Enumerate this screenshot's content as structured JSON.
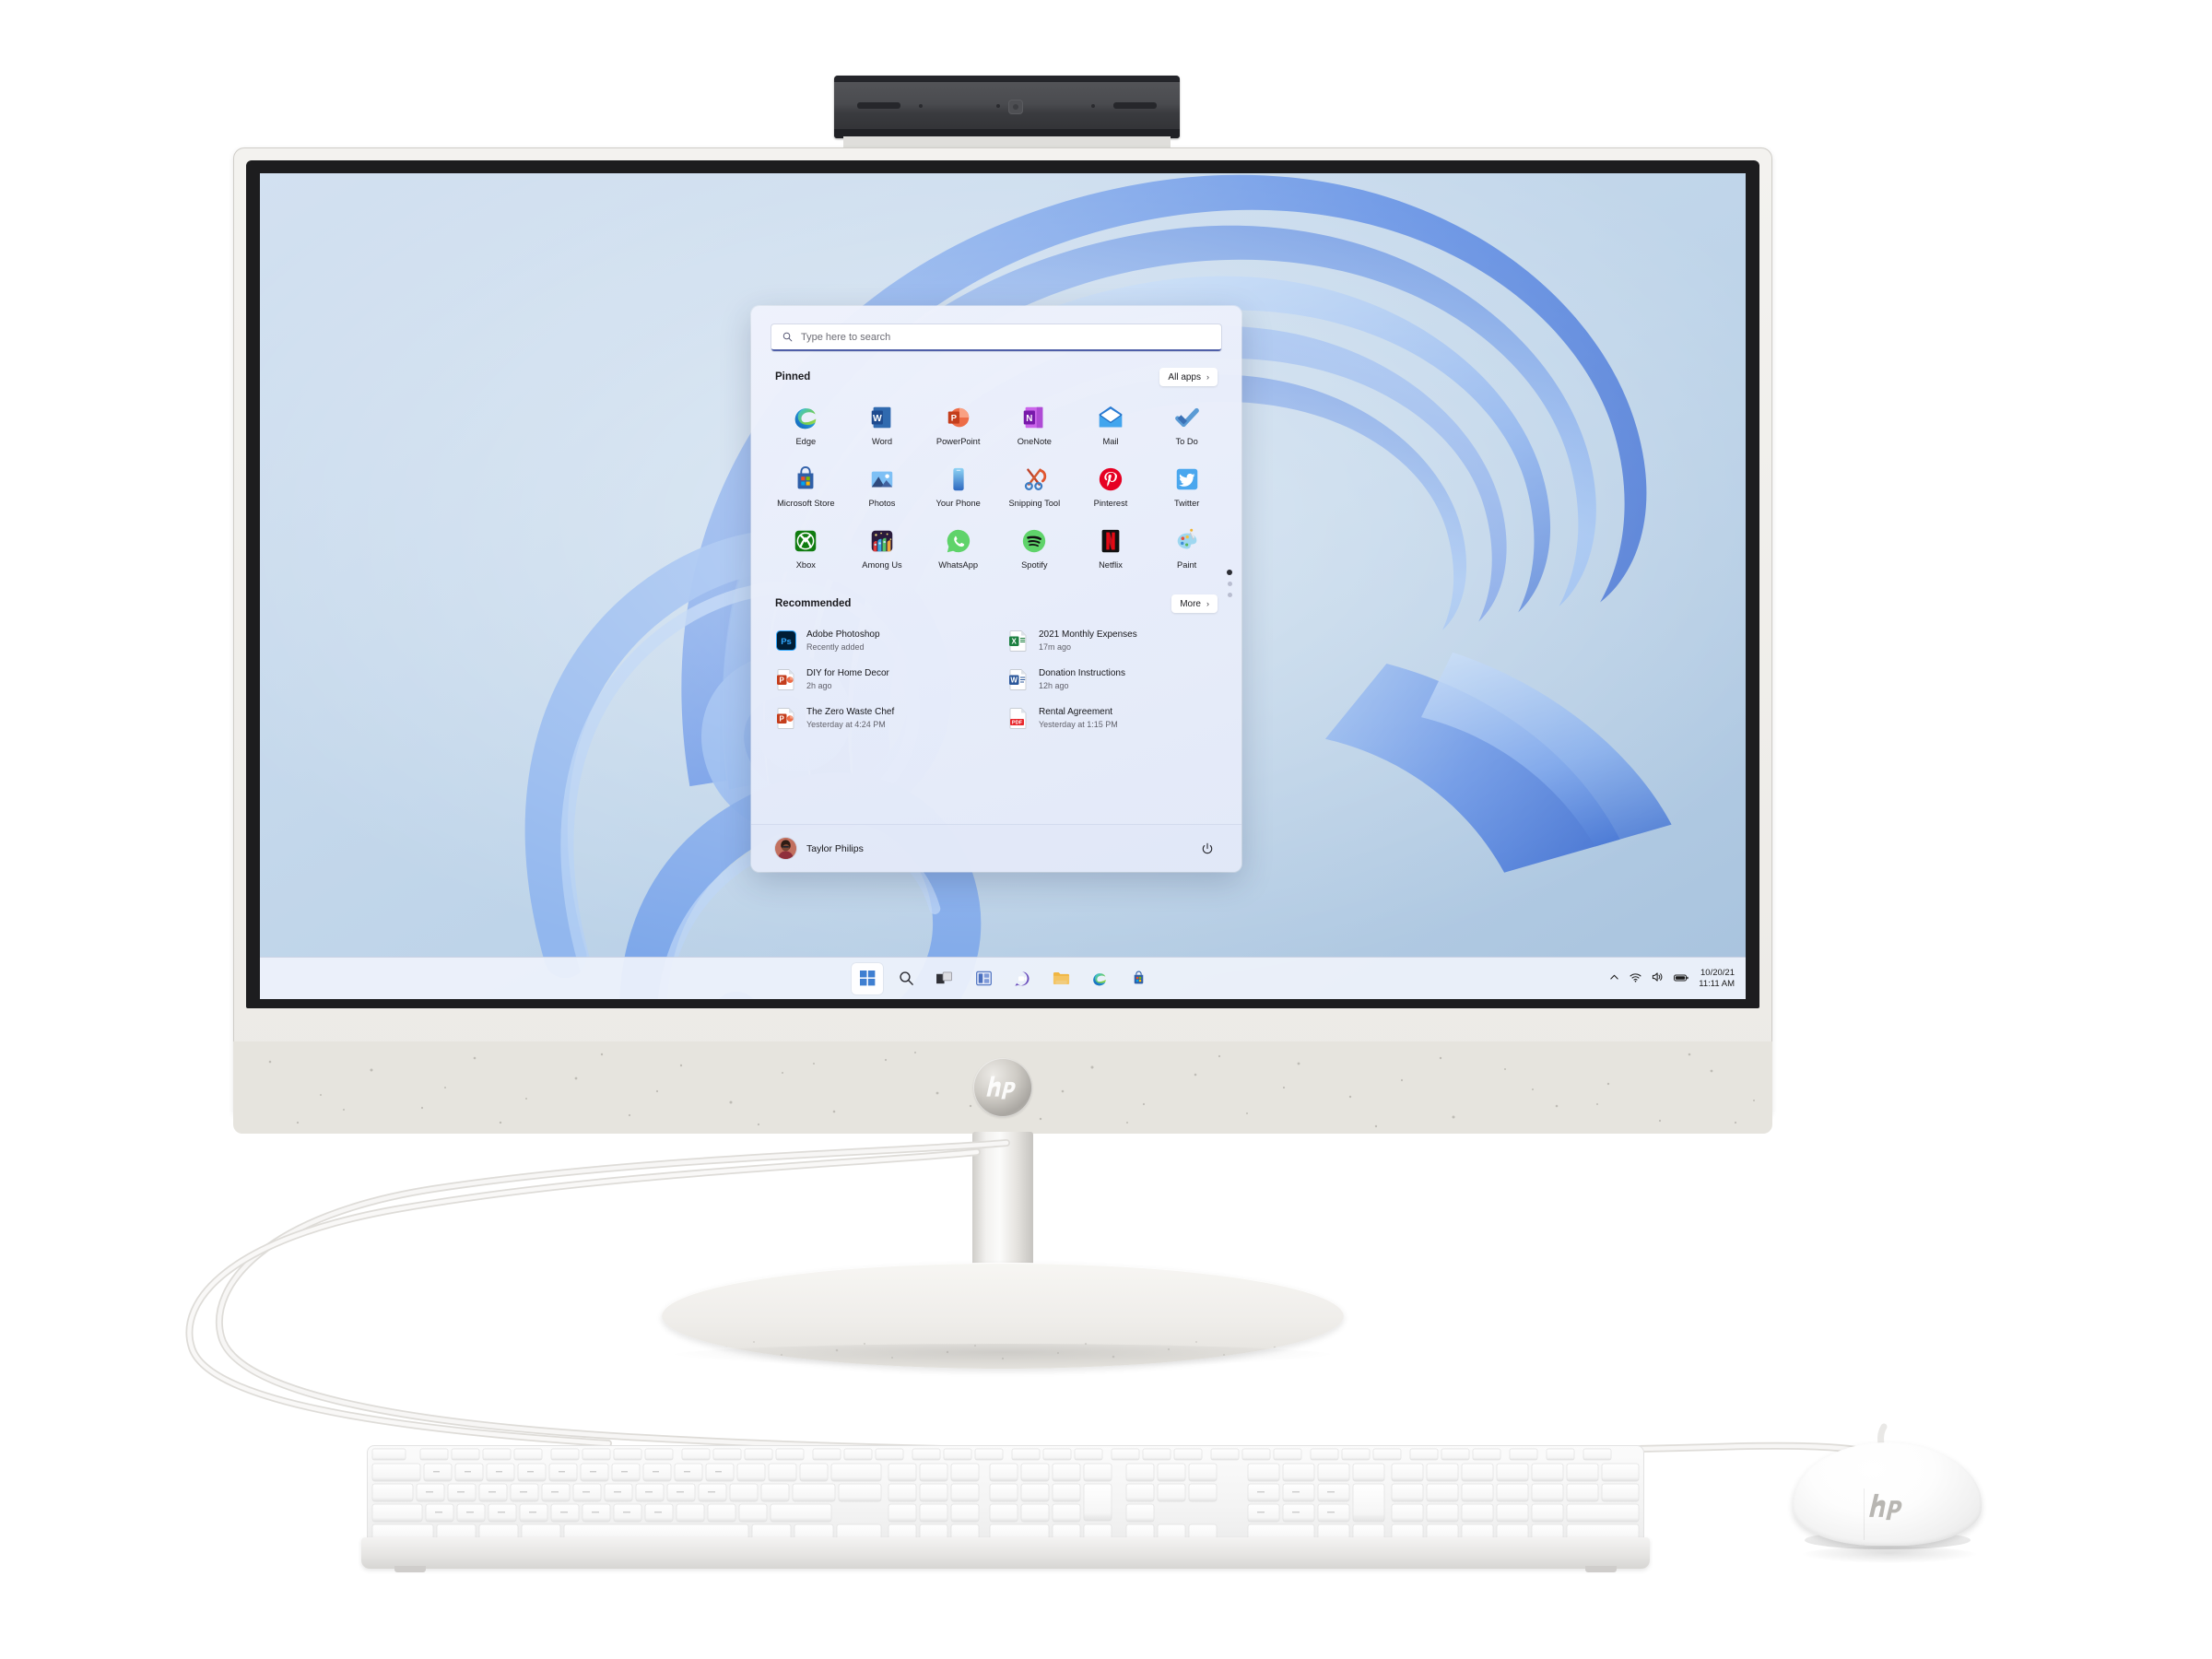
{
  "device": {
    "brand": "hp",
    "webcam_label": "pop-up-webcam",
    "logo_label": "hp"
  },
  "desktop": {
    "wallpaper_name": "windows-11-bloom"
  },
  "start_menu": {
    "search": {
      "placeholder": "Type here to search",
      "value": "",
      "icon": "search-icon"
    },
    "pinned": {
      "title": "Pinned",
      "all_apps_label": "All apps",
      "all_apps_chevron": "›",
      "apps": [
        {
          "label": "Edge",
          "icon": "edge-icon"
        },
        {
          "label": "Word",
          "icon": "word-icon"
        },
        {
          "label": "PowerPoint",
          "icon": "powerpoint-icon"
        },
        {
          "label": "OneNote",
          "icon": "onenote-icon"
        },
        {
          "label": "Mail",
          "icon": "mail-icon"
        },
        {
          "label": "To Do",
          "icon": "todo-icon"
        },
        {
          "label": "Microsoft Store",
          "icon": "microsoft-store-icon"
        },
        {
          "label": "Photos",
          "icon": "photos-icon"
        },
        {
          "label": "Your Phone",
          "icon": "your-phone-icon"
        },
        {
          "label": "Snipping Tool",
          "icon": "snipping-tool-icon"
        },
        {
          "label": "Pinterest",
          "icon": "pinterest-icon"
        },
        {
          "label": "Twitter",
          "icon": "twitter-icon"
        },
        {
          "label": "Xbox",
          "icon": "xbox-icon"
        },
        {
          "label": "Among Us",
          "icon": "among-us-icon"
        },
        {
          "label": "WhatsApp",
          "icon": "whatsapp-icon"
        },
        {
          "label": "Spotify",
          "icon": "spotify-icon"
        },
        {
          "label": "Netflix",
          "icon": "netflix-icon"
        },
        {
          "label": "Paint",
          "icon": "paint-icon"
        }
      ],
      "page_dots": 3,
      "active_page": 1
    },
    "recommended": {
      "title": "Recommended",
      "more_label": "More",
      "more_chevron": "›",
      "items": [
        {
          "title": "Adobe Photoshop",
          "subtitle": "Recently added",
          "icon": "photoshop-icon"
        },
        {
          "title": "2021 Monthly Expenses",
          "subtitle": "17m ago",
          "icon": "excel-file-icon"
        },
        {
          "title": "DIY for Home Decor",
          "subtitle": "2h ago",
          "icon": "powerpoint-file-icon"
        },
        {
          "title": "Donation Instructions",
          "subtitle": "12h ago",
          "icon": "word-file-icon"
        },
        {
          "title": "The Zero Waste Chef",
          "subtitle": "Yesterday at 4:24 PM",
          "icon": "powerpoint-file-icon"
        },
        {
          "title": "Rental Agreement",
          "subtitle": "Yesterday at 1:15 PM",
          "icon": "pdf-file-icon"
        }
      ]
    },
    "footer": {
      "user_name": "Taylor Philips",
      "avatar": "user-avatar",
      "power_icon": "power-icon"
    }
  },
  "taskbar": {
    "buttons": [
      {
        "name": "start-button",
        "icon": "windows-logo-icon",
        "active": true
      },
      {
        "name": "search-button",
        "icon": "search-icon",
        "active": false
      },
      {
        "name": "task-view-button",
        "icon": "task-view-icon",
        "active": false
      },
      {
        "name": "widgets-button",
        "icon": "widgets-icon",
        "active": false
      },
      {
        "name": "chat-button",
        "icon": "teams-chat-icon",
        "active": false
      },
      {
        "name": "file-explorer-button",
        "icon": "folder-icon",
        "active": false
      },
      {
        "name": "edge-button",
        "icon": "edge-icon",
        "active": false
      },
      {
        "name": "store-button",
        "icon": "microsoft-store-icon",
        "active": false
      }
    ],
    "tray": {
      "chevron_icon": "chevron-up-icon",
      "wifi_icon": "wifi-icon",
      "volume_icon": "volume-icon",
      "battery_icon": "battery-icon",
      "date": "10/20/21",
      "time": "11:11 AM"
    }
  },
  "colors": {
    "accent": "#4f5fa8",
    "taskbar_bg": "#eef2fb",
    "start_bg": "#eaeefb",
    "chassis": "#e6e4de",
    "bezel": "#1d1d1f"
  },
  "peripherals": {
    "keyboard": "hp-wired-keyboard",
    "mouse": "hp-wired-mouse"
  }
}
